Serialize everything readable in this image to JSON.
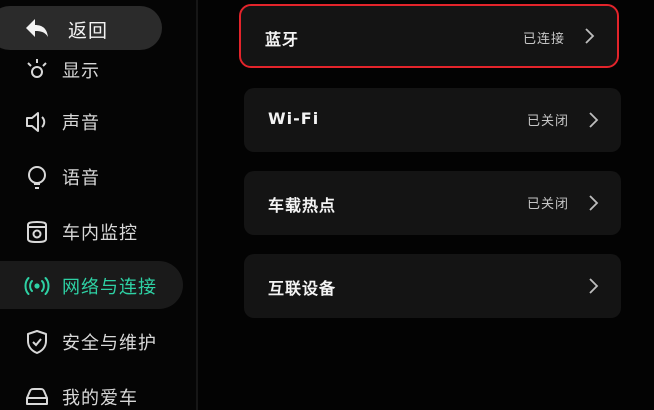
{
  "sidebar": {
    "back": {
      "label": "返回",
      "icon": "back-arrow-icon"
    },
    "items": [
      {
        "label": "显示",
        "icon": "display-icon"
      },
      {
        "label": "声音",
        "icon": "speaker-icon"
      },
      {
        "label": "语音",
        "icon": "voice-bulb-icon"
      },
      {
        "label": "车内监控",
        "icon": "camera-icon"
      },
      {
        "label": "网络与连接",
        "icon": "signal-icon",
        "active": true
      },
      {
        "label": "安全与维护",
        "icon": "shield-check-icon"
      },
      {
        "label": "我的爱车",
        "icon": "car-icon"
      }
    ]
  },
  "main": {
    "rows": [
      {
        "title": "蓝牙",
        "status": "已连接",
        "highlighted": true
      },
      {
        "title": "Wi-Fi",
        "status": "已关闭"
      },
      {
        "title": "车载热点",
        "status": "已关闭"
      },
      {
        "title": "互联设备",
        "status": ""
      }
    ]
  },
  "colors": {
    "accent": "#2ed1a4",
    "highlight_border": "#e3242b",
    "card_bg": "#141414",
    "background": "#030303"
  }
}
